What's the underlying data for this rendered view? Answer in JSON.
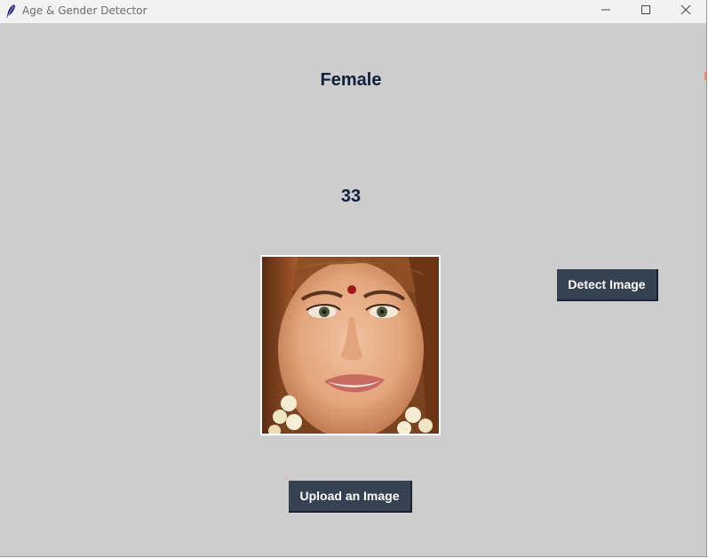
{
  "window": {
    "title": "Age & Gender Detector",
    "icon": "feather-icon",
    "controls": [
      "minimize-icon",
      "maximize-icon",
      "close-icon"
    ]
  },
  "result": {
    "gender": "Female",
    "age": "33"
  },
  "image": {
    "content": "face-photo"
  },
  "buttons": {
    "detect_label": "Detect Image",
    "upload_label": "Upload an Image"
  },
  "colors": {
    "background": "#cdcdcd",
    "button": "#364152",
    "button_text": "#ffffff",
    "label_text": "#0f1f3d",
    "titlebar": "#f3f3f3"
  }
}
